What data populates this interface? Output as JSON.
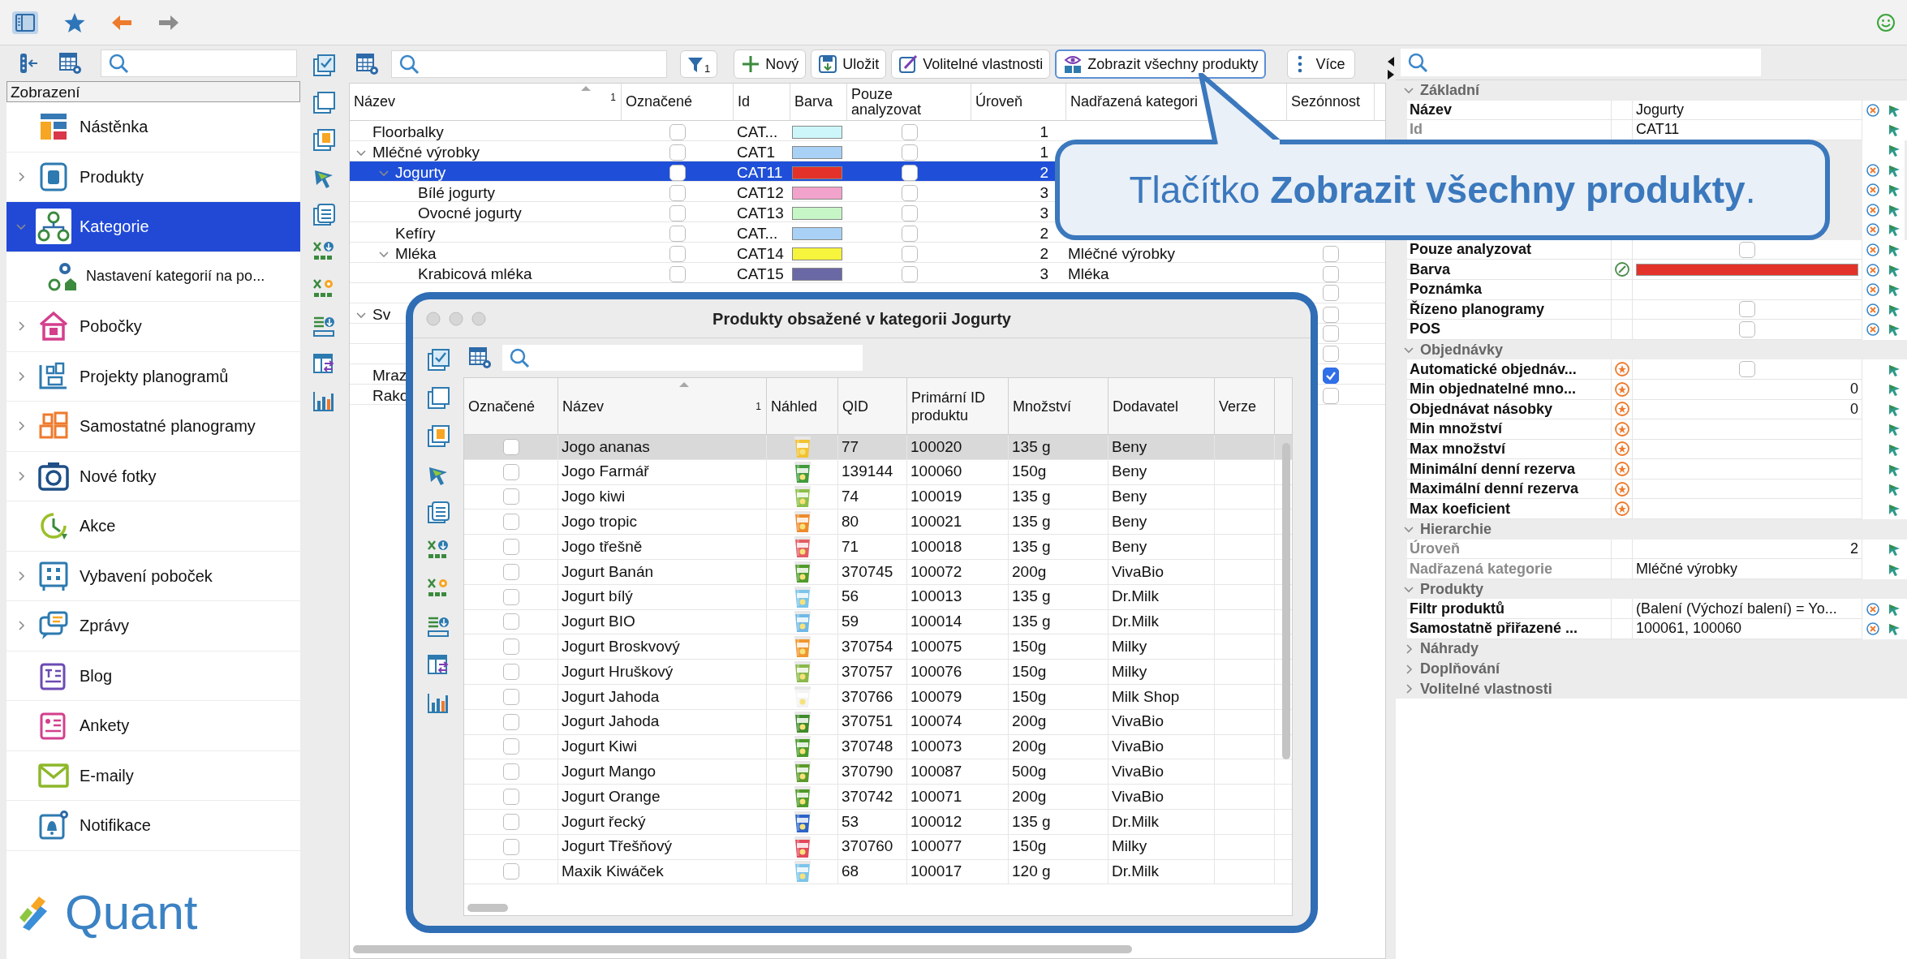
{
  "sidebar": {
    "header": "Zobrazení",
    "items": [
      {
        "label": "Nástěnka",
        "selected": false
      },
      {
        "label": "Produkty",
        "expanded": false,
        "selected": false
      },
      {
        "label": "Kategorie",
        "expanded": true,
        "selected": true,
        "children": [
          {
            "label": "Nastavení kategorií na po...",
            "selected": false
          }
        ]
      },
      {
        "label": "Pobočky",
        "expanded": false,
        "selected": false
      },
      {
        "label": "Projekty planogramů",
        "expanded": false,
        "selected": false
      },
      {
        "label": "Samostatné planogramy",
        "expanded": false,
        "selected": false
      },
      {
        "label": "Nové fotky",
        "expanded": false,
        "selected": false
      },
      {
        "label": "Akce",
        "selected": false
      },
      {
        "label": "Vybavení poboček",
        "expanded": false,
        "selected": false
      },
      {
        "label": "Zprávy",
        "expanded": false,
        "selected": false
      },
      {
        "label": "Blog",
        "selected": false
      },
      {
        "label": "Ankety",
        "selected": false
      },
      {
        "label": "E-maily",
        "selected": false
      },
      {
        "label": "Notifikace",
        "selected": false
      }
    ]
  },
  "logo": {
    "text": "Quant"
  },
  "toolbar": {
    "filter_count": "1",
    "buttons": [
      {
        "label": "Nový",
        "focused": false
      },
      {
        "label": "Uložit",
        "focused": false
      },
      {
        "label": "Volitelné vlastnosti",
        "focused": false
      },
      {
        "label": "Zobrazit všechny produkty",
        "focused": true
      },
      {
        "label": "Více",
        "focused": false
      }
    ]
  },
  "category_table": {
    "sort_index": "1",
    "columns": [
      "Název",
      "Označené",
      "Id",
      "Barva",
      "Pouze analyzovat",
      "Úroveň",
      "Nadřazená kategori",
      "Sezónnost"
    ],
    "rows": [
      {
        "name": "Floorbalky",
        "marked": false,
        "id": "CAT...",
        "color": "#ccf6fa",
        "analyze_only": false,
        "level": "1",
        "selected": false
      },
      {
        "name": "Mléčné výrobky",
        "marked": false,
        "id": "CAT1",
        "color": "#a9d0f5",
        "analyze_only": false,
        "level": "1",
        "selected": false,
        "expanded": true,
        "children": [
          {
            "name": "Jogurty",
            "marked": false,
            "id": "CAT11",
            "color": "#e3322a",
            "analyze_only": false,
            "level": "2",
            "selected": true,
            "expanded": true,
            "children": [
              {
                "name": "Bílé jogurty",
                "marked": false,
                "id": "CAT12",
                "color": "#f2a3cb",
                "analyze_only": false,
                "level": "3",
                "selected": false
              },
              {
                "name": "Ovocné jogurty",
                "marked": false,
                "id": "CAT13",
                "color": "#c6f5c6",
                "analyze_only": false,
                "level": "3",
                "selected": false
              }
            ]
          },
          {
            "name": "Kefíry",
            "marked": false,
            "id": "CAT...",
            "color": "#a9d0f5",
            "analyze_only": false,
            "level": "2",
            "selected": false
          },
          {
            "name": "Mléka",
            "marked": false,
            "id": "CAT14",
            "color": "#f6f43c",
            "analyze_only": false,
            "level": "2",
            "parent": "Mléčné výrobky",
            "seasonal": false,
            "selected": false,
            "expanded": true,
            "children": [
              {
                "name": "Krabicová mléka",
                "marked": false,
                "id": "CAT15",
                "color": "#6b68a6",
                "analyze_only": false,
                "level": "3",
                "parent": "Mléka",
                "seasonal": false,
                "selected": false
              },
              {
                "seasonal": false,
                "selected": false
              }
            ]
          }
        ]
      },
      {
        "name": "Sv",
        "seasonal": false,
        "selected": false,
        "expanded": true,
        "children": [
          {
            "seasonal": false,
            "selected": false
          },
          {
            "seasonal": false,
            "selected": false
          }
        ]
      },
      {
        "name": "Mraz",
        "seasonal": true,
        "selected": false
      },
      {
        "name": "Rako",
        "seasonal": false,
        "selected": false
      }
    ]
  },
  "properties": {
    "sections": [
      {
        "title": "Základní",
        "expanded": true,
        "rows": [
          {
            "label": "Název",
            "kind": "text",
            "value": "Jogurty",
            "readonly": false,
            "reset": true
          },
          {
            "label": "Id",
            "kind": "text",
            "value": "CAT11",
            "readonly": true,
            "reset": false
          },
          {
            "kind": "hidden",
            "reset": false
          },
          {
            "kind": "hidden",
            "reset": true
          },
          {
            "kind": "hidden",
            "reset": true
          },
          {
            "kind": "hidden",
            "reset": true
          },
          {
            "kind": "hidden",
            "reset": true
          },
          {
            "label": "Pouze analyzovat",
            "kind": "checkbox",
            "checked": false,
            "readonly": false,
            "reset": true
          },
          {
            "label": "Barva",
            "kind": "color",
            "color": "#e3322a",
            "picker": true,
            "readonly": false,
            "reset": true
          },
          {
            "label": "Poznámka",
            "kind": "empty",
            "readonly": false,
            "reset": true
          },
          {
            "label": "Řízeno planogramy",
            "kind": "checkbox",
            "checked": false,
            "readonly": false,
            "reset": true
          },
          {
            "label": "POS",
            "kind": "checkbox",
            "checked": false,
            "readonly": false,
            "reset": true
          }
        ]
      },
      {
        "title": "Objednávky",
        "expanded": true,
        "rows": [
          {
            "label": "Automatické objednáv...",
            "kind": "checkbox",
            "checked": false,
            "inherited": true,
            "readonly": false,
            "reset": false
          },
          {
            "label": "Min objednatelné mno...",
            "kind": "number",
            "value": "0",
            "inherited": true,
            "readonly": false,
            "reset": false
          },
          {
            "label": "Objednávat násobky",
            "kind": "number",
            "value": "0",
            "inherited": true,
            "readonly": false,
            "reset": false
          },
          {
            "label": "Min množství",
            "kind": "empty",
            "inherited": true,
            "readonly": false,
            "reset": false
          },
          {
            "label": "Max množství",
            "kind": "empty",
            "inherited": true,
            "readonly": false,
            "reset": false
          },
          {
            "label": "Minimální denní rezerva",
            "kind": "empty",
            "inherited": true,
            "readonly": false,
            "reset": false
          },
          {
            "label": "Maximální denní rezerva",
            "kind": "empty",
            "inherited": true,
            "readonly": false,
            "reset": false
          },
          {
            "label": "Max koeficient",
            "kind": "empty",
            "inherited": true,
            "readonly": false,
            "reset": false
          }
        ]
      },
      {
        "title": "Hierarchie",
        "expanded": true,
        "rows": [
          {
            "label": "Úroveň",
            "kind": "number",
            "value": "2",
            "readonly": true,
            "reset": false
          },
          {
            "label": "Nadřazená kategorie",
            "kind": "text",
            "value": "Mléčné výrobky",
            "readonly": true,
            "reset": false
          }
        ]
      },
      {
        "title": "Produkty",
        "expanded": true,
        "rows": [
          {
            "label": "Filtr produktů",
            "kind": "text",
            "value": "(Balení (Výchozí balení) = Yo...",
            "readonly": false,
            "reset": true
          },
          {
            "label": "Samostatně přiřazené ...",
            "kind": "text",
            "value": "100061, 100060",
            "readonly": false,
            "reset": true
          }
        ]
      },
      {
        "title": "Náhrady",
        "expanded": false
      },
      {
        "title": "Doplňování",
        "expanded": false
      },
      {
        "title": "Volitelné vlastnosti",
        "expanded": false
      }
    ]
  },
  "dialog": {
    "title": "Produkty obsažené v kategorii Jogurty",
    "sort_index": "1",
    "columns": [
      "Označené",
      "Název",
      "Náhled",
      "QID",
      "Primární ID produktu",
      "Množství",
      "Dodavatel",
      "Verze"
    ],
    "rows": [
      {
        "marked": false,
        "name": "Jogo ananas",
        "qid": "77",
        "primary_id": "100020",
        "quantity": "135 g",
        "supplier": "Beny",
        "selected": true
      },
      {
        "marked": false,
        "name": "Jogo Farmář",
        "qid": "139144",
        "primary_id": "100060",
        "quantity": "150g",
        "supplier": "Beny",
        "selected": false
      },
      {
        "marked": false,
        "name": "Jogo kiwi",
        "qid": "74",
        "primary_id": "100019",
        "quantity": "135 g",
        "supplier": "Beny",
        "selected": false
      },
      {
        "marked": false,
        "name": "Jogo tropic",
        "qid": "80",
        "primary_id": "100021",
        "quantity": "135 g",
        "supplier": "Beny",
        "selected": false
      },
      {
        "marked": false,
        "name": "Jogo třešně",
        "qid": "71",
        "primary_id": "100018",
        "quantity": "135 g",
        "supplier": "Beny",
        "selected": false
      },
      {
        "marked": false,
        "name": "Jogurt Banán",
        "qid": "370745",
        "primary_id": "100072",
        "quantity": "200g",
        "supplier": "VivaBio",
        "selected": false
      },
      {
        "marked": false,
        "name": "Jogurt bílý",
        "qid": "56",
        "primary_id": "100013",
        "quantity": "135 g",
        "supplier": "Dr.Milk",
        "selected": false
      },
      {
        "marked": false,
        "name": "Jogurt BIO",
        "qid": "59",
        "primary_id": "100014",
        "quantity": "135 g",
        "supplier": "Dr.Milk",
        "selected": false
      },
      {
        "marked": false,
        "name": "Jogurt Broskvový",
        "qid": "370754",
        "primary_id": "100075",
        "quantity": "150g",
        "supplier": "Milky",
        "selected": false
      },
      {
        "marked": false,
        "name": "Jogurt Hruškový",
        "qid": "370757",
        "primary_id": "100076",
        "quantity": "150g",
        "supplier": "Milky",
        "selected": false
      },
      {
        "marked": false,
        "name": "Jogurt Jahoda",
        "qid": "370766",
        "primary_id": "100079",
        "quantity": "150g",
        "supplier": "Milk Shop",
        "selected": false
      },
      {
        "marked": false,
        "name": "Jogurt Jahoda",
        "qid": "370751",
        "primary_id": "100074",
        "quantity": "200g",
        "supplier": "VivaBio",
        "selected": false
      },
      {
        "marked": false,
        "name": "Jogurt Kiwi",
        "qid": "370748",
        "primary_id": "100073",
        "quantity": "200g",
        "supplier": "VivaBio",
        "selected": false
      },
      {
        "marked": false,
        "name": "Jogurt Mango",
        "qid": "370790",
        "primary_id": "100087",
        "quantity": "500g",
        "supplier": "VivaBio",
        "selected": false
      },
      {
        "marked": false,
        "name": "Jogurt Orange",
        "qid": "370742",
        "primary_id": "100071",
        "quantity": "200g",
        "supplier": "VivaBio",
        "selected": false
      },
      {
        "marked": false,
        "name": "Jogurt řecký",
        "qid": "53",
        "primary_id": "100012",
        "quantity": "135 g",
        "supplier": "Dr.Milk",
        "selected": false
      },
      {
        "marked": false,
        "name": "Jogurt Třešňový",
        "qid": "370760",
        "primary_id": "100077",
        "quantity": "150g",
        "supplier": "Milky",
        "selected": false
      },
      {
        "marked": false,
        "name": "Maxik Kiwáček",
        "qid": "68",
        "primary_id": "100017",
        "quantity": "120 g",
        "supplier": "Dr.Milk",
        "selected": false
      }
    ]
  },
  "callout": {
    "text": "Tlačítko **Zobrazit všechny produkty**."
  }
}
